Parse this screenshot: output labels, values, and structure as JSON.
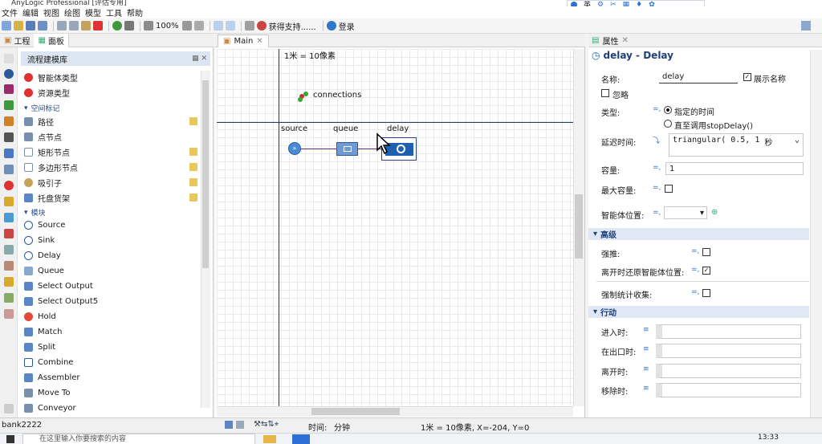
{
  "window": {
    "title": "AnyLogic Professional [评估专用]"
  },
  "menu": [
    "文件",
    "编辑",
    "视图",
    "绘图",
    "模型",
    "工具",
    "帮助"
  ],
  "floatbar": {
    "lang": "英"
  },
  "toolbar": {
    "zoom": "100%",
    "support": "获得支持......",
    "login": "登录"
  },
  "left_panel": {
    "tabs": [
      "工程",
      "面板"
    ],
    "header": "流程建模库",
    "top_items": [
      {
        "label": "智能体类型",
        "icon_color": "#d33"
      },
      {
        "label": "资源类型",
        "icon_color": "#d33"
      }
    ],
    "section_space": "空间标记",
    "space_items": [
      {
        "label": "路径",
        "editable": true
      },
      {
        "label": "点节点",
        "editable": false
      },
      {
        "label": "矩形节点",
        "editable": true
      },
      {
        "label": "多边形节点",
        "editable": true
      },
      {
        "label": "吸引子",
        "editable": true
      },
      {
        "label": "托盘货架",
        "editable": true
      }
    ],
    "section_blocks": "模块",
    "block_items": [
      "Source",
      "Sink",
      "Delay",
      "Queue",
      "Select Output",
      "Select Output5",
      "Hold",
      "Match",
      "Split",
      "Combine",
      "Assembler",
      "Move To",
      "Conveyor"
    ]
  },
  "editor": {
    "tab": "Main",
    "scale_label": "1米 = 10像素",
    "connections_label": "connections",
    "blocks": [
      "source",
      "queue",
      "delay"
    ]
  },
  "properties": {
    "tab": "属性",
    "title": "delay - Delay",
    "name_label": "名称:",
    "name_value": "delay",
    "show_name": "展示名称",
    "ignore": "忽略",
    "type_label": "类型:",
    "type_opt1": "指定的时间",
    "type_opt2": "直至调用stopDelay()",
    "delay_label": "延迟时间:",
    "delay_value": "triangular( 0.5, 1",
    "delay_unit": "秒",
    "capacity_label": "容量:",
    "capacity_value": "1",
    "maxcap_label": "最大容量:",
    "agentpos_label": "智能体位置:",
    "section_advanced": "高级",
    "force_push": "强推:",
    "restore_pos": "离开时还原智能体位置:",
    "force_stats": "强制统计收集:",
    "section_actions": "行动",
    "on_enter": "进入时:",
    "on_exit_point": "在出口时:",
    "on_exit": "离开时:",
    "on_remove": "移除时:"
  },
  "status": {
    "left": "bank2222",
    "time_label": "时间:",
    "time_unit": "分钟",
    "coords": "1米 = 10像素, X=-204, Y=0"
  },
  "taskbar": {
    "search_placeholder": "在这里输入你要搜索的内容",
    "clock": "13:33"
  }
}
